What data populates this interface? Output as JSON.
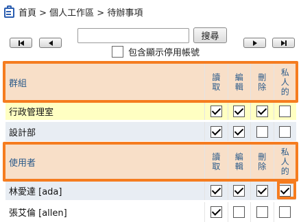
{
  "breadcrumb": {
    "text": "首頁 > 個人工作區 > 待辦事項"
  },
  "search": {
    "value": "",
    "button_label": "搜尋"
  },
  "options": {
    "include_disabled_label": "包含顯示停用帳號",
    "include_disabled_checked": false
  },
  "group_table": {
    "header_label": "群組",
    "columns": [
      {
        "chars": [
          "讀",
          "取"
        ]
      },
      {
        "chars": [
          "編",
          "輯"
        ]
      },
      {
        "chars": [
          "刪",
          "除"
        ]
      },
      {
        "chars": [
          "私",
          "人",
          "的"
        ]
      }
    ],
    "rows": [
      {
        "name": "行政管理室",
        "perms": [
          true,
          true,
          true,
          false
        ]
      },
      {
        "name": "設計部",
        "perms": [
          true,
          true,
          false,
          false
        ]
      }
    ]
  },
  "user_table": {
    "header_label": "使用者",
    "columns": [
      {
        "chars": [
          "讀",
          "取"
        ]
      },
      {
        "chars": [
          "編",
          "輯"
        ]
      },
      {
        "chars": [
          "刪",
          "除"
        ]
      },
      {
        "chars": [
          "私",
          "人",
          "的"
        ]
      }
    ],
    "rows": [
      {
        "name": "林愛達 [ada]",
        "perms": [
          true,
          true,
          true,
          true
        ]
      },
      {
        "name": "張艾倫 [allen]",
        "perms": [
          true,
          false,
          false,
          false
        ]
      }
    ]
  },
  "colors": {
    "highlight": "#f57c1f",
    "header_bg": "#f8dfc8",
    "header_text": "#2a5a8a"
  }
}
